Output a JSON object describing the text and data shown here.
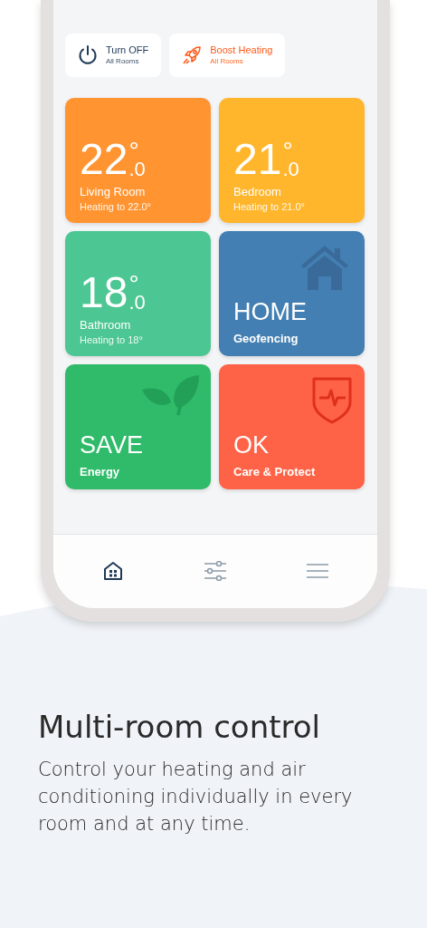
{
  "quick_actions": [
    {
      "kind": "off",
      "title": "Turn OFF",
      "subtitle": "All Rooms"
    },
    {
      "kind": "boost",
      "title": "Boost Heating",
      "subtitle": "All Rooms"
    }
  ],
  "tiles": [
    {
      "kind": "room",
      "color": "#ff9431",
      "temperature": "22",
      "decimal": ".0",
      "degree": "°",
      "name": "Living Room",
      "status": "Heating to 22.0°"
    },
    {
      "kind": "room",
      "color": "#ffb62c",
      "temperature": "21",
      "decimal": ".0",
      "degree": "°",
      "name": "Bedroom",
      "status": "Heating to 21.0°"
    },
    {
      "kind": "room",
      "color": "#4cc692",
      "temperature": "18",
      "decimal": ".0",
      "degree": "°",
      "name": "Bathroom",
      "status": "Heating to 18°"
    },
    {
      "kind": "home",
      "color": "#437fb2",
      "title": "HOME",
      "subtitle": "Geofencing"
    },
    {
      "kind": "save",
      "color": "#2fbb6a",
      "title": "SAVE",
      "subtitle": "Energy"
    },
    {
      "kind": "care",
      "color": "#ff6347",
      "title": "OK",
      "subtitle": "Care & Protect"
    }
  ],
  "tab_bar": [
    {
      "kind": "home",
      "selected": true
    },
    {
      "kind": "settings",
      "selected": false
    },
    {
      "kind": "menu",
      "selected": false
    }
  ],
  "headline": "Multi-room control",
  "description": "Control your heating and air conditioning individually in every room and at any time."
}
